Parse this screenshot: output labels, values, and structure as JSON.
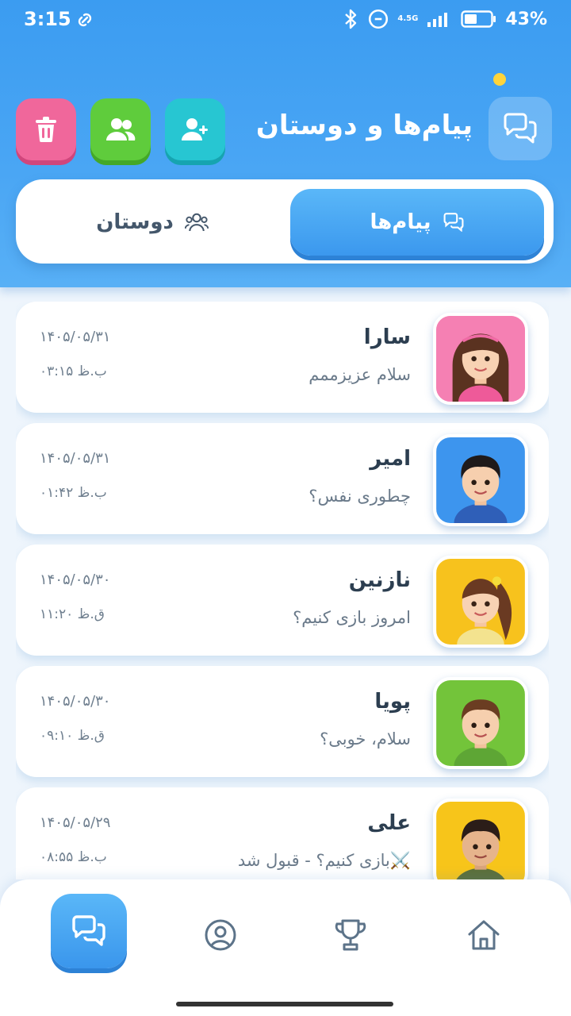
{
  "status_bar": {
    "time": "3:15",
    "network": "4.5G",
    "battery": "43%"
  },
  "header": {
    "title": "پیام‌ها و دوستان",
    "icons": [
      "chat-bubbles-icon",
      "trash-icon",
      "friends-icon",
      "add-user-icon"
    ]
  },
  "tabs": {
    "messages": "پیام‌ها",
    "friends": "دوستان"
  },
  "conversations": [
    {
      "name": "سارا",
      "preview": "سلام عزیزممم",
      "date": "۱۴۰۵/۰۵/۳۱",
      "time": "ب.ظ ۰۳:۱۵"
    },
    {
      "name": "امیر",
      "preview": "چطوری نفس؟",
      "date": "۱۴۰۵/۰۵/۳۱",
      "time": "ب.ظ ۰۱:۴۲"
    },
    {
      "name": "نازنین",
      "preview": "امروز بازی کنیم؟",
      "date": "۱۴۰۵/۰۵/۳۰",
      "time": "ق.ظ ۱۱:۲۰"
    },
    {
      "name": "پویا",
      "preview": "سلام، خوبی؟",
      "date": "۱۴۰۵/۰۵/۳۰",
      "time": "ق.ظ ۰۹:۱۰"
    },
    {
      "name": "علی",
      "preview": "⚔️بازی کنیم؟ - قبول شد",
      "date": "۱۴۰۵/۰۵/۲۹",
      "time": "ب.ظ ۰۸:۵۵"
    }
  ],
  "colors": {
    "header_blue": "#3b9cf1",
    "delete_pink": "#f0679b",
    "friends_green": "#5fcc3c",
    "add_teal": "#27c6d2"
  }
}
